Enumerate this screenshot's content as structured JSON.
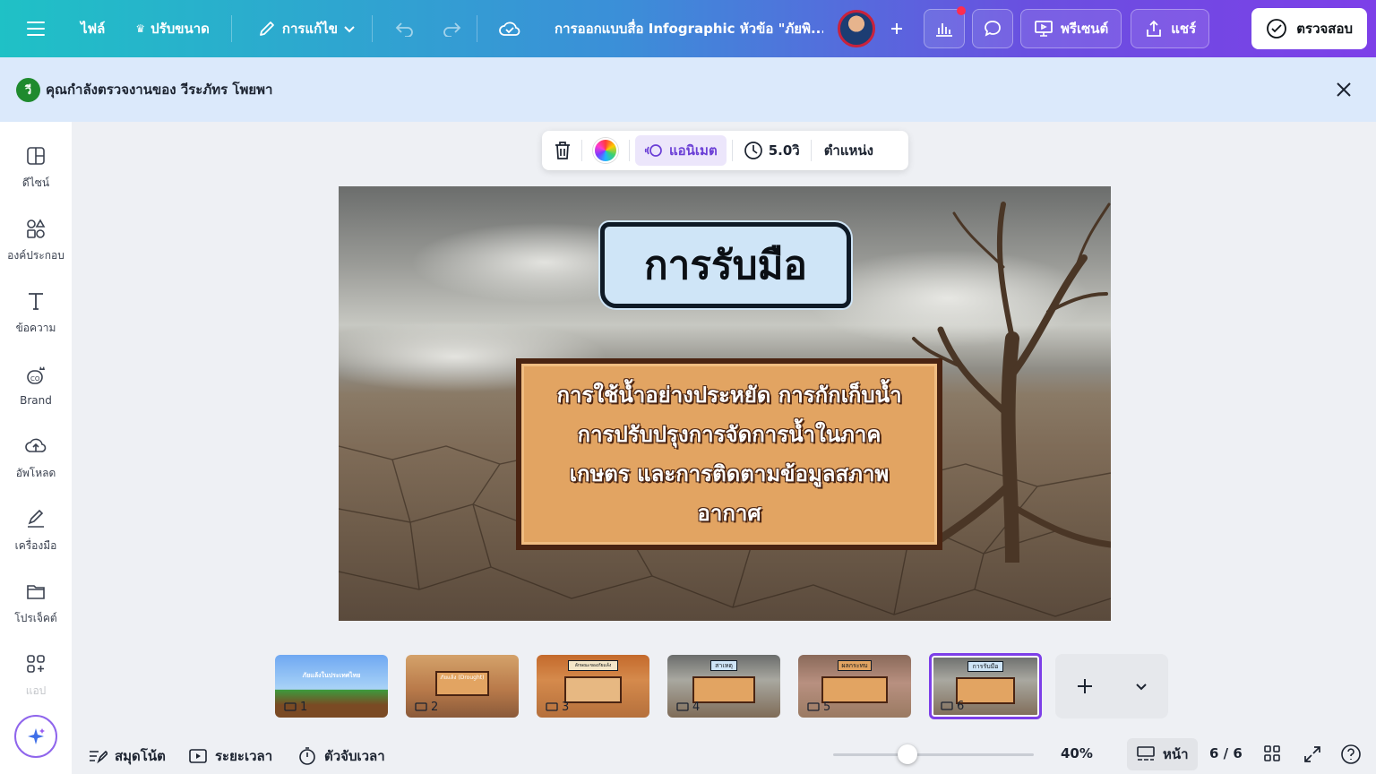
{
  "topbar": {
    "file": "ไฟล์",
    "resize": "ปรับขนาด",
    "edit": "การแก้ไข",
    "doc_title": "การออกแบบสื่อ Infographic หัวข้อ \"ภัยพิ...",
    "present": "พรีเซนต์",
    "share": "แชร์",
    "review": "ตรวจสอบ"
  },
  "banner": {
    "badge": "วี",
    "text": "คุณกำลังตรวจงานของ วีระภัทร โพยพา"
  },
  "sidebar": {
    "items": [
      {
        "label": "ดีไซน์",
        "icon": "design-icon"
      },
      {
        "label": "องค์ประกอบ",
        "icon": "elements-icon"
      },
      {
        "label": "ข้อความ",
        "icon": "text-icon"
      },
      {
        "label": "Brand",
        "icon": "brand-icon"
      },
      {
        "label": "อัพโหลด",
        "icon": "upload-icon"
      },
      {
        "label": "เครื่องมือ",
        "icon": "tools-icon"
      },
      {
        "label": "โปรเจ็คต์",
        "icon": "projects-icon"
      },
      {
        "label": "แอป",
        "icon": "apps-icon"
      }
    ]
  },
  "element_toolbar": {
    "animate": "แอนิเมต",
    "duration": "5.0วิ",
    "position": "ตำแหน่ง"
  },
  "slide": {
    "title": "การรับมือ",
    "body": "การใช้น้ำอย่างประหยัด การกักเก็บน้ำ การปรับปรุงการจัดการน้ำในภาคเกษตร และการติดตามข้อมูลสภาพอากาศ"
  },
  "thumbnails": [
    {
      "num": "1",
      "caption": "ภัยแล้งในประเทศไทย",
      "selected": false
    },
    {
      "num": "2",
      "caption": "ภัยแล้ง (Drought)",
      "selected": false
    },
    {
      "num": "3",
      "caption": "ลักษณะของภัยแล้ง",
      "selected": false
    },
    {
      "num": "4",
      "caption": "สาเหตุ",
      "selected": false
    },
    {
      "num": "5",
      "caption": "ผลกระทบ",
      "selected": false
    },
    {
      "num": "6",
      "caption": "การรับมือ",
      "selected": true
    }
  ],
  "bottombar": {
    "notes": "สมุดโน้ต",
    "duration": "ระยะเวลา",
    "timer": "ตัวจับเวลา",
    "zoom": "40%",
    "pages_label": "หน้า",
    "page_count": "6 / 6"
  },
  "colors": {
    "accent": "#7d3fe8",
    "banner_bg": "#dbe9fb",
    "wood": "#e2a462"
  }
}
